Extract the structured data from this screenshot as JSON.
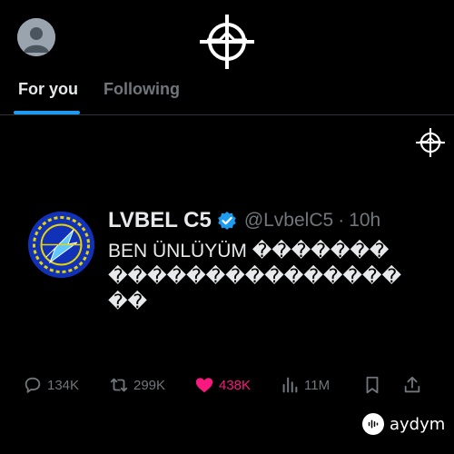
{
  "header": {
    "avatar_icon": "default-avatar-icon",
    "logo_icon": "crosshair-logo-icon"
  },
  "tabs": [
    {
      "label": "For you",
      "active": true
    },
    {
      "label": "Following",
      "active": false
    }
  ],
  "colors": {
    "accent": "#1d9bf0",
    "like": "#f91880",
    "muted": "#71767b",
    "text": "#e7e9ea",
    "background": "#000000"
  },
  "post": {
    "display_name": "LVBEL C5",
    "verified": true,
    "handle": "@LvbelC5",
    "separator": "·",
    "time": "10h",
    "text": "BEN ÜNLÜYÜM ������������������������",
    "actions": {
      "replies": "134K",
      "reposts": "299K",
      "likes": "438K",
      "views": "11M"
    }
  },
  "watermark": {
    "label": "aydym"
  }
}
